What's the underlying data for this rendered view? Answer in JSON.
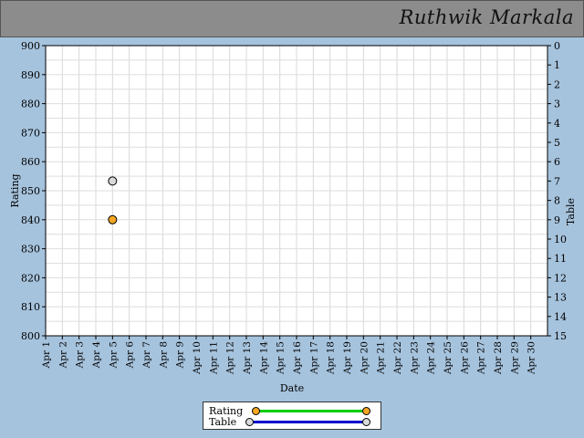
{
  "header": {
    "name": "Ruthwik Markala"
  },
  "chart_data": {
    "type": "scatter",
    "title": "",
    "xlabel": "Date",
    "ylabel": "Rating",
    "y2label": "Table",
    "categories": [
      "Apr 1",
      "Apr 2",
      "Apr 3",
      "Apr 4",
      "Apr 5",
      "Apr 6",
      "Apr 7",
      "Apr 8",
      "Apr 9",
      "Apr 10",
      "Apr 11",
      "Apr 12",
      "Apr 13",
      "Apr 14",
      "Apr 15",
      "Apr 16",
      "Apr 17",
      "Apr 18",
      "Apr 19",
      "Apr 20",
      "Apr 21",
      "Apr 22",
      "Apr 23",
      "Apr 24",
      "Apr 25",
      "Apr 26",
      "Apr 27",
      "Apr 28",
      "Apr 29",
      "Apr 30"
    ],
    "ylim": [
      800,
      900
    ],
    "yticks": [
      800,
      810,
      820,
      830,
      840,
      850,
      860,
      870,
      880,
      890,
      900
    ],
    "y2lim": [
      0,
      15
    ],
    "y2ticks": [
      0,
      1,
      2,
      3,
      4,
      5,
      6,
      7,
      8,
      9,
      10,
      11,
      12,
      13,
      14,
      15
    ],
    "y2_inverted": true,
    "grid": true,
    "legend_position": "bottom-center",
    "series": [
      {
        "name": "Rating",
        "axis": "left",
        "color": "#00cc00",
        "marker_color": "#f5a623",
        "points": [
          {
            "x": "Apr 5",
            "y": 840
          }
        ]
      },
      {
        "name": "Table",
        "axis": "right",
        "color": "#0000cc",
        "marker_color": "#d9d9d9",
        "points": [
          {
            "x": "Apr 5",
            "y": 7
          }
        ]
      }
    ]
  }
}
